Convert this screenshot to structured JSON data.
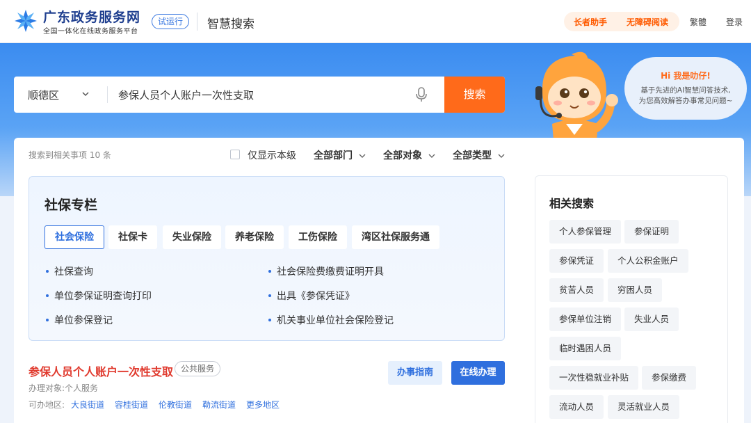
{
  "header": {
    "site_title": "广东政务服务网",
    "site_subtitle": "全国一体化在线政务服务平台",
    "trial_badge": "试运行",
    "section_name": "智慧搜索",
    "senior_assistant": "长者助手",
    "accessible_reading": "无障碍阅读",
    "traditional": "繁體",
    "login": "登录",
    "brand_color": "#1f3f8f",
    "accent_color": "#ff6a1a"
  },
  "search": {
    "region": "顺德区",
    "query": "参保人员个人账户一次性支取",
    "button": "搜索",
    "mic_icon": "microphone-icon"
  },
  "assistant": {
    "greeting": "Hi 我是叻仔!",
    "line1": "基于先进的AI智慧问答技术,",
    "line2": "为您高效解答办事常见问题~"
  },
  "filters": {
    "result_count": "搜索到相关事项 10 条",
    "only_local": "仅显示本级",
    "dept": "全部部门",
    "target": "全部对象",
    "type": "全部类型"
  },
  "social_panel": {
    "title": "社保专栏",
    "tabs": [
      "社会保险",
      "社保卡",
      "失业保险",
      "养老保险",
      "工伤保险",
      "湾区社保服务通"
    ],
    "active_tab": 0,
    "links_left": [
      "社保查询",
      "单位参保证明查询打印",
      "单位参保登记"
    ],
    "links_right": [
      "社会保险费缴费证明开具",
      "出具《参保凭证》",
      "机关事业单位社会保险登记"
    ]
  },
  "result": {
    "title": "参保人员个人账户一次性支取",
    "badge": "公共服务",
    "target": "办理对象:个人服务",
    "area_label": "可办地区:",
    "areas": [
      "大良街道",
      "容桂街道",
      "伦教街道",
      "勒流街道",
      "更多地区"
    ],
    "guide_btn": "办事指南",
    "online_btn": "在线办理"
  },
  "related": {
    "title": "相关搜索",
    "tags": [
      "个人参保管理",
      "参保证明",
      "参保凭证",
      "个人公积金账户",
      "贫苦人员",
      "穷困人员",
      "参保单位注销",
      "失业人员",
      "临时遇困人员",
      "一次性稳就业补贴",
      "参保缴费",
      "流动人员",
      "灵活就业人员"
    ]
  }
}
